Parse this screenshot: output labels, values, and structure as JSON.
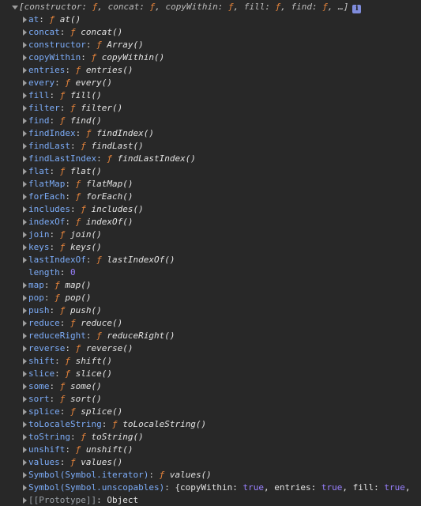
{
  "header": {
    "bracket_open": "[",
    "bracket_close": "]",
    "items": [
      {
        "key": "constructor",
        "f": "ƒ"
      },
      {
        "key": "concat",
        "f": "ƒ"
      },
      {
        "key": "copyWithin",
        "f": "ƒ"
      },
      {
        "key": "fill",
        "f": "ƒ"
      },
      {
        "key": "find",
        "f": "ƒ"
      }
    ],
    "ellipsis": "…",
    "info": "i"
  },
  "methods": [
    {
      "key": "at",
      "f": "ƒ",
      "sig": "at()"
    },
    {
      "key": "concat",
      "f": "ƒ",
      "sig": "concat()"
    },
    {
      "key": "constructor",
      "f": "ƒ",
      "sig": "Array()"
    },
    {
      "key": "copyWithin",
      "f": "ƒ",
      "sig": "copyWithin()"
    },
    {
      "key": "entries",
      "f": "ƒ",
      "sig": "entries()"
    },
    {
      "key": "every",
      "f": "ƒ",
      "sig": "every()"
    },
    {
      "key": "fill",
      "f": "ƒ",
      "sig": "fill()"
    },
    {
      "key": "filter",
      "f": "ƒ",
      "sig": "filter()"
    },
    {
      "key": "find",
      "f": "ƒ",
      "sig": "find()"
    },
    {
      "key": "findIndex",
      "f": "ƒ",
      "sig": "findIndex()"
    },
    {
      "key": "findLast",
      "f": "ƒ",
      "sig": "findLast()"
    },
    {
      "key": "findLastIndex",
      "f": "ƒ",
      "sig": "findLastIndex()"
    },
    {
      "key": "flat",
      "f": "ƒ",
      "sig": "flat()"
    },
    {
      "key": "flatMap",
      "f": "ƒ",
      "sig": "flatMap()"
    },
    {
      "key": "forEach",
      "f": "ƒ",
      "sig": "forEach()"
    },
    {
      "key": "includes",
      "f": "ƒ",
      "sig": "includes()"
    },
    {
      "key": "indexOf",
      "f": "ƒ",
      "sig": "indexOf()"
    },
    {
      "key": "join",
      "f": "ƒ",
      "sig": "join()"
    },
    {
      "key": "keys",
      "f": "ƒ",
      "sig": "keys()"
    },
    {
      "key": "lastIndexOf",
      "f": "ƒ",
      "sig": "lastIndexOf()"
    }
  ],
  "length": {
    "key": "length",
    "value": "0"
  },
  "methods2": [
    {
      "key": "map",
      "f": "ƒ",
      "sig": "map()"
    },
    {
      "key": "pop",
      "f": "ƒ",
      "sig": "pop()"
    },
    {
      "key": "push",
      "f": "ƒ",
      "sig": "push()"
    },
    {
      "key": "reduce",
      "f": "ƒ",
      "sig": "reduce()"
    },
    {
      "key": "reduceRight",
      "f": "ƒ",
      "sig": "reduceRight()"
    },
    {
      "key": "reverse",
      "f": "ƒ",
      "sig": "reverse()"
    },
    {
      "key": "shift",
      "f": "ƒ",
      "sig": "shift()"
    },
    {
      "key": "slice",
      "f": "ƒ",
      "sig": "slice()"
    },
    {
      "key": "some",
      "f": "ƒ",
      "sig": "some()"
    },
    {
      "key": "sort",
      "f": "ƒ",
      "sig": "sort()"
    },
    {
      "key": "splice",
      "f": "ƒ",
      "sig": "splice()"
    },
    {
      "key": "toLocaleString",
      "f": "ƒ",
      "sig": "toLocaleString()"
    },
    {
      "key": "toString",
      "f": "ƒ",
      "sig": "toString()"
    },
    {
      "key": "unshift",
      "f": "ƒ",
      "sig": "unshift()"
    },
    {
      "key": "values",
      "f": "ƒ",
      "sig": "values()"
    }
  ],
  "symbol_iterator": {
    "key": "Symbol(Symbol.iterator)",
    "f": "ƒ",
    "sig": "values()"
  },
  "symbol_unscopables": {
    "key": "Symbol(Symbol.unscopables)",
    "value": "{copyWithin: true, entries: true, fill: true,"
  },
  "prototype": {
    "key": "[[Prototype]]",
    "value": "Object"
  },
  "colors": {
    "background": "#282828",
    "key": "#7cacf8",
    "function_f": "#e8853b",
    "number": "#9980ff",
    "text": "#e3e3e3"
  }
}
